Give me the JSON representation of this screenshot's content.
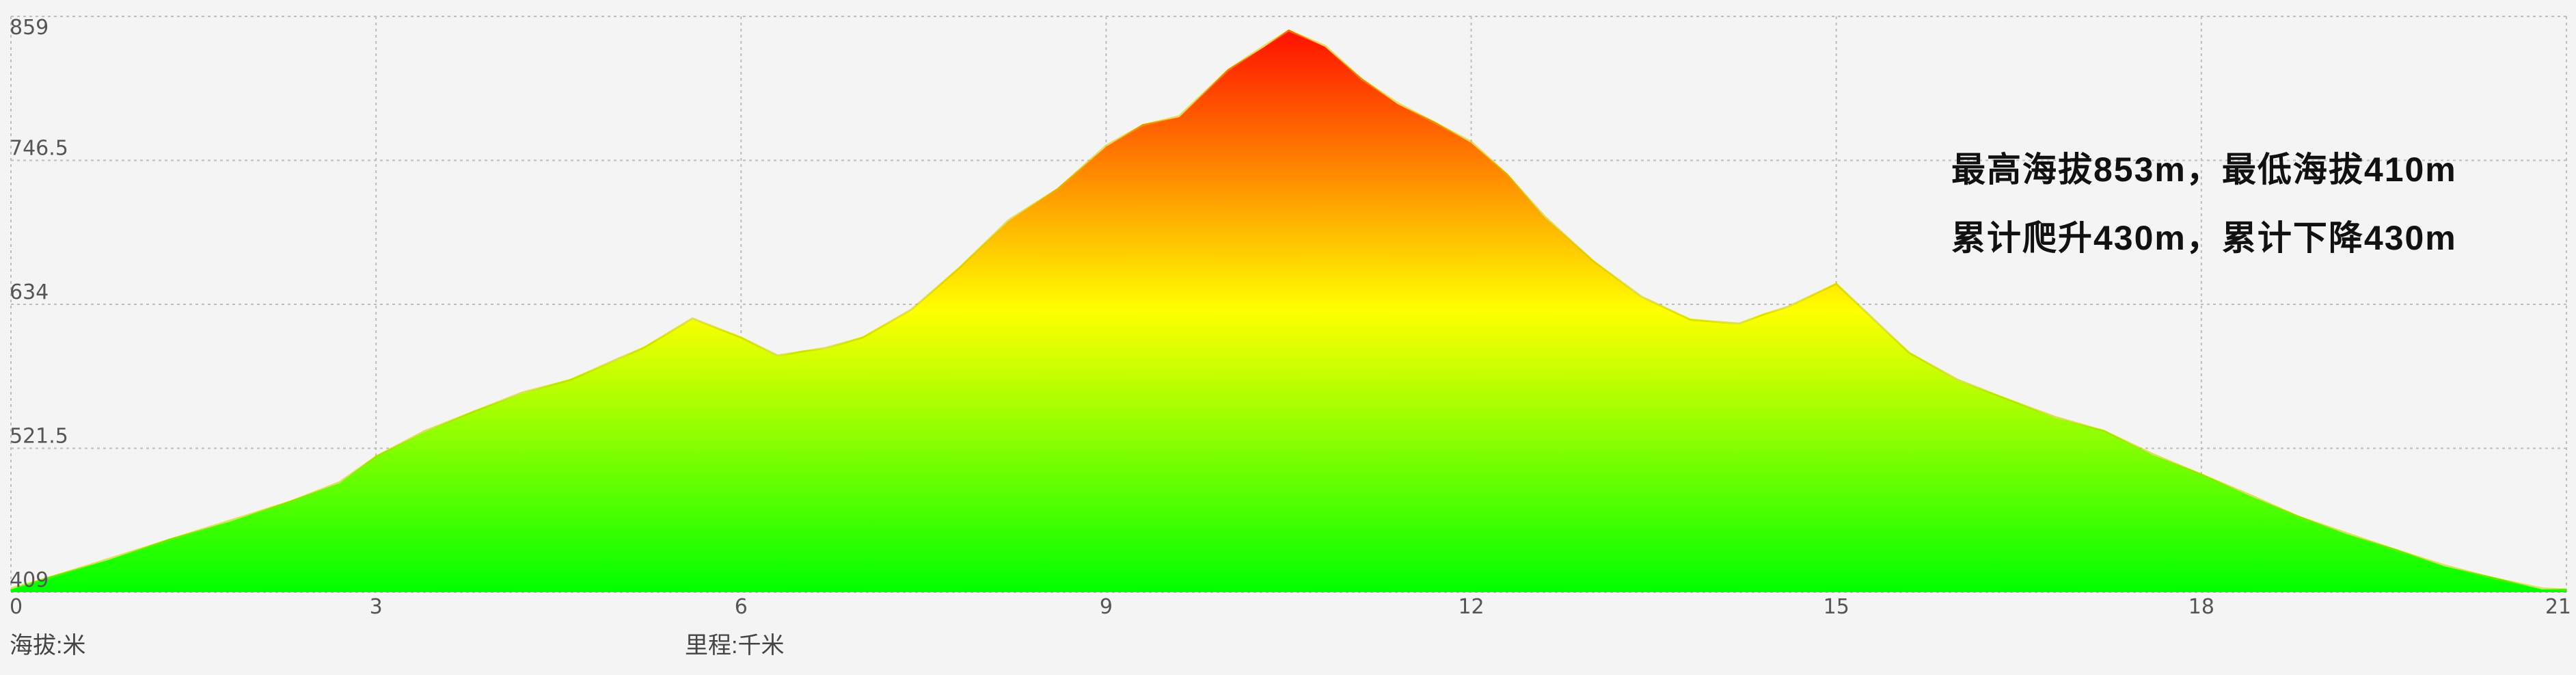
{
  "chart_data": {
    "type": "area",
    "x_unit_label": "里程:千米",
    "y_unit_label": "海拔:米",
    "xlim": [
      0,
      21
    ],
    "ylim": [
      409,
      859
    ],
    "x_ticks": [
      "0",
      "3",
      "6",
      "9",
      "12",
      "15",
      "18",
      "21"
    ],
    "y_ticks": [
      "859",
      "746.5",
      "634",
      "521.5",
      "409"
    ],
    "grid": true,
    "annotations": [
      "最高海拔853m，最低海拔410m",
      "累计爬升430m，累计下降430m"
    ],
    "colors": {
      "low": "#00ff00",
      "mid": "#ffff00",
      "high": "#ff1000",
      "grid": "#bbbbbb",
      "background": "#f4f4f4"
    },
    "series": [
      {
        "x": [
          0,
          0.3,
          0.8,
          1.3,
          1.8,
          2.3,
          2.7,
          3.0,
          3.4,
          3.8,
          4.2,
          4.6,
          5.0,
          5.2,
          5.6,
          6.0,
          6.3,
          6.5,
          6.7,
          7.0,
          7.4,
          7.8,
          8.2,
          8.6,
          9.0,
          9.3,
          9.6,
          10.0,
          10.3,
          10.5,
          10.8,
          11.1,
          11.4,
          11.7,
          12.0,
          12.3,
          12.6,
          13.0,
          13.4,
          13.8,
          14.2,
          14.4,
          14.6,
          15.0,
          15.3,
          15.6,
          16.0,
          16.4,
          16.8,
          17.2,
          17.6,
          18.0,
          18.4,
          18.8,
          19.2,
          19.6,
          20.0,
          20.4,
          20.8,
          21.0
        ],
        "y": [
          412,
          420,
          435,
          450,
          465,
          480,
          495,
          515,
          535,
          550,
          565,
          575,
          592,
          600,
          623,
          608,
          594,
          597,
          600,
          608,
          630,
          663,
          700,
          724,
          758,
          774,
          781,
          817,
          836,
          848,
          836,
          810,
          791,
          776,
          761,
          735,
          703,
          668,
          640,
          622,
          619,
          626,
          632,
          650,
          623,
          596,
          575,
          560,
          546,
          535,
          517,
          501,
          485,
          468,
          455,
          442,
          430,
          420,
          412,
          411
        ]
      }
    ]
  }
}
